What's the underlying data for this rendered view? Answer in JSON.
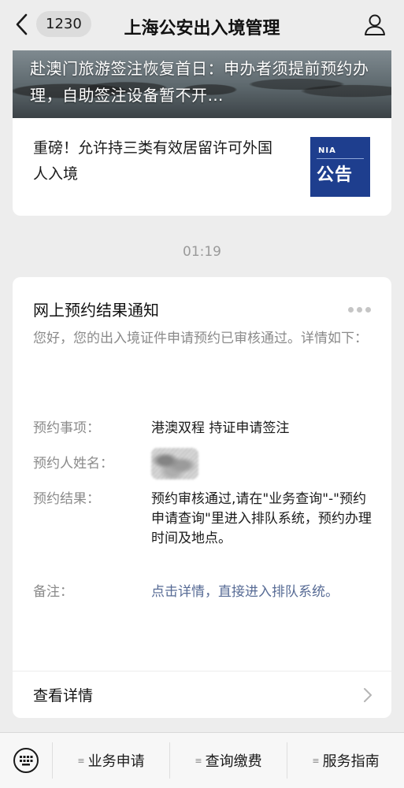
{
  "header": {
    "badge": "1230",
    "title": "上海公安出入境管理",
    "icons": [
      "back-chevron-icon",
      "user-icon"
    ]
  },
  "articles": {
    "headline": "赴澳门旅游签注恢复首日：申办者须提前预约办理，自助签注设备暂不开…",
    "second_title": "重磅！允许持三类有效居留许可外国人入境",
    "thumb_top": "NIA",
    "thumb_main": "公告"
  },
  "timestamp": "01:19",
  "notice": {
    "title": "网上预约结果通知",
    "greeting": "您好，您的出入境证件申请预约已审核通过。详情如下：",
    "rows": [
      {
        "label": "预约事项：",
        "value": "港澳双程 持证申请签注"
      },
      {
        "label": "预约人姓名：",
        "value": ""
      },
      {
        "label": "预约结果：",
        "value": "预约审核通过,请在\"业务查询\"-\"预约申请查询\"里进入排队系统，预约办理时间及地点。"
      },
      {
        "label": "备注：",
        "value": "点击详情，直接进入排队系统。"
      }
    ],
    "view_detail": "查看详情"
  },
  "bottom_menu": {
    "items": [
      "业务申请",
      "查询缴费",
      "服务指南"
    ],
    "icons": [
      "keyboard-icon",
      "menu-lines-icon"
    ]
  },
  "colors": {
    "background": "#ededed",
    "card": "#ffffff",
    "link": "#576b95",
    "secondary_text": "#8a8a8a",
    "thumb_blue": "#1e3e8e"
  }
}
